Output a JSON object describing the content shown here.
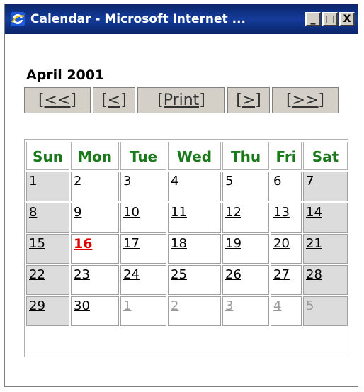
{
  "window": {
    "title": "Calendar - Microsoft Internet ...",
    "minimize_label": "_",
    "maximize_label": "□",
    "close_label": "X"
  },
  "calendar": {
    "month_title": "April 2001",
    "nav": {
      "first": "[<<]",
      "prev": "[<]",
      "print": "[Print]",
      "next": "[>]",
      "last": "[>>]"
    },
    "weekdays": [
      "Sun",
      "Mon",
      "Tue",
      "Wed",
      "Thu",
      "Fri",
      "Sat"
    ],
    "weeks": [
      [
        "1",
        "2",
        "3",
        "4",
        "5",
        "6",
        "7"
      ],
      [
        "8",
        "9",
        "10",
        "11",
        "12",
        "13",
        "14"
      ],
      [
        "15",
        "16",
        "17",
        "18",
        "19",
        "20",
        "21"
      ],
      [
        "22",
        "23",
        "24",
        "25",
        "26",
        "27",
        "28"
      ],
      [
        "29",
        "30",
        "1",
        "2",
        "3",
        "4",
        "5"
      ]
    ],
    "today": "16",
    "colors": {
      "header_text": "#1a7a1a",
      "today_text": "#e00000",
      "weekend_bg": "#dcdcdc",
      "other_month_text": "#999999"
    }
  }
}
